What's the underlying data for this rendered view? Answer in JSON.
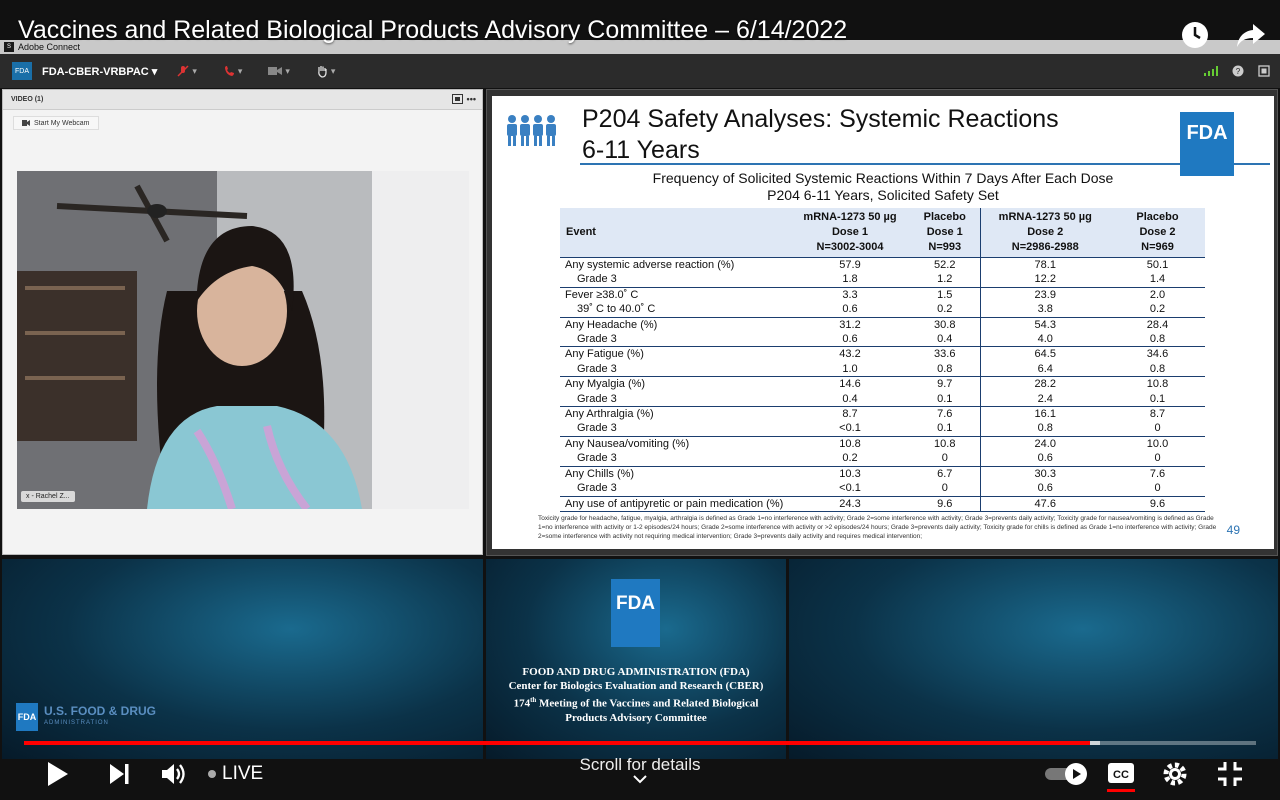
{
  "youtube": {
    "title": "Vaccines and Related Biological Products Advisory Committee – 6/14/2022",
    "live_label": "LIVE",
    "scroll_hint": "Scroll for details",
    "progress_fraction": 0.865,
    "buffer_fraction": 0.873,
    "accent_color": "#ff0000"
  },
  "app": {
    "window_title": "Adobe Connect",
    "room_name": "FDA-CBER-VRBPAC",
    "room_logo": "FDA"
  },
  "video_pod": {
    "header": "VIDEO (1)",
    "webcam_button": "Start My Webcam",
    "participant_name": "x - Rachel Z..."
  },
  "slide": {
    "title_line1": "P204 Safety Analyses: Systemic Reactions",
    "title_line2": "6-11 Years",
    "logo": "FDA",
    "subtitle1": "Frequency of Solicited Systemic Reactions Within 7 Days After Each Dose",
    "subtitle2": "P204 6-11 Years, Solicited Safety Set",
    "headers": {
      "event": "Event",
      "c1": [
        "mRNA-1273 50 µg",
        "Dose 1",
        "N=3002-3004"
      ],
      "c2": [
        "Placebo",
        "Dose 1",
        "N=993"
      ],
      "c3": [
        "mRNA-1273 50 µg",
        "Dose 2",
        "N=2986-2988"
      ],
      "c4": [
        "Placebo",
        "Dose 2",
        "N=969"
      ]
    },
    "rows": [
      {
        "event": "Any systemic adverse reaction (%)",
        "sub": false,
        "end": false,
        "v": [
          "57.9",
          "52.2",
          "78.1",
          "50.1"
        ]
      },
      {
        "event": "Grade 3",
        "sub": true,
        "end": true,
        "v": [
          "1.8",
          "1.2",
          "12.2",
          "1.4"
        ]
      },
      {
        "event": "Fever ≥38.0˚ C",
        "sub": false,
        "end": false,
        "v": [
          "3.3",
          "1.5",
          "23.9",
          "2.0"
        ]
      },
      {
        "event": "39˚ C to 40.0˚ C",
        "sub": true,
        "end": true,
        "v": [
          "0.6",
          "0.2",
          "3.8",
          "0.2"
        ]
      },
      {
        "event": "Any Headache (%)",
        "sub": false,
        "end": false,
        "v": [
          "31.2",
          "30.8",
          "54.3",
          "28.4"
        ]
      },
      {
        "event": "Grade 3",
        "sub": true,
        "end": true,
        "v": [
          "0.6",
          "0.4",
          "4.0",
          "0.8"
        ]
      },
      {
        "event": "Any Fatigue (%)",
        "sub": false,
        "end": false,
        "v": [
          "43.2",
          "33.6",
          "64.5",
          "34.6"
        ]
      },
      {
        "event": "Grade 3",
        "sub": true,
        "end": true,
        "v": [
          "1.0",
          "0.8",
          "6.4",
          "0.8"
        ]
      },
      {
        "event": "Any Myalgia (%)",
        "sub": false,
        "end": false,
        "v": [
          "14.6",
          "9.7",
          "28.2",
          "10.8"
        ]
      },
      {
        "event": "Grade 3",
        "sub": true,
        "end": true,
        "v": [
          "0.4",
          "0.1",
          "2.4",
          "0.1"
        ]
      },
      {
        "event": "Any Arthralgia (%)",
        "sub": false,
        "end": false,
        "v": [
          "8.7",
          "7.6",
          "16.1",
          "8.7"
        ]
      },
      {
        "event": "Grade 3",
        "sub": true,
        "end": true,
        "v": [
          "<0.1",
          "0.1",
          "0.8",
          "0"
        ]
      },
      {
        "event": "Any Nausea/vomiting (%)",
        "sub": false,
        "end": false,
        "v": [
          "10.8",
          "10.8",
          "24.0",
          "10.0"
        ]
      },
      {
        "event": "Grade 3",
        "sub": true,
        "end": true,
        "v": [
          "0.2",
          "0",
          "0.6",
          "0"
        ]
      },
      {
        "event": "Any Chills (%)",
        "sub": false,
        "end": false,
        "v": [
          "10.3",
          "6.7",
          "30.3",
          "7.6"
        ]
      },
      {
        "event": "Grade 3",
        "sub": true,
        "end": true,
        "v": [
          "<0.1",
          "0",
          "0.6",
          "0"
        ]
      },
      {
        "event": "Any use of antipyretic or pain medication (%)",
        "sub": false,
        "end": true,
        "v": [
          "24.3",
          "9.6",
          "47.6",
          "9.6"
        ]
      }
    ],
    "footnote": "Toxicity grade for headache, fatigue, myalgia, arthralgia is defined as Grade 1=no interference with activity; Grade 2=some interference with activity; Grade 3=prevents daily activity; Toxicity grade for nausea/vomiting is defined as Grade 1=no interference with activity or 1-2 episodes/24 hours; Grade 2=some interference with activity or >2 episodes/24 hours; Grade 3=prevents daily activity; Toxicity grade for chills is defined as Grade 1=no interference with activity; Grade 2=some interference with activity not requiring medical intervention; Grade 3=prevents daily activity and requires medical intervention;",
    "page_number": "49"
  },
  "bottom": {
    "left_logo_box": "FDA",
    "left_logo_title": "U.S. FOOD & DRUG",
    "left_logo_sub": "ADMINISTRATION",
    "center_logo": "FDA",
    "center_line1": "FOOD AND DRUG ADMINISTRATION (FDA)",
    "center_line2": "Center for Biologics Evaluation and Research (CBER)",
    "center_line3_num": "174",
    "center_line3_sup": "th",
    "center_line3_rest": " Meeting of the Vaccines and Related Biological",
    "center_line4": "Products Advisory Committee"
  }
}
